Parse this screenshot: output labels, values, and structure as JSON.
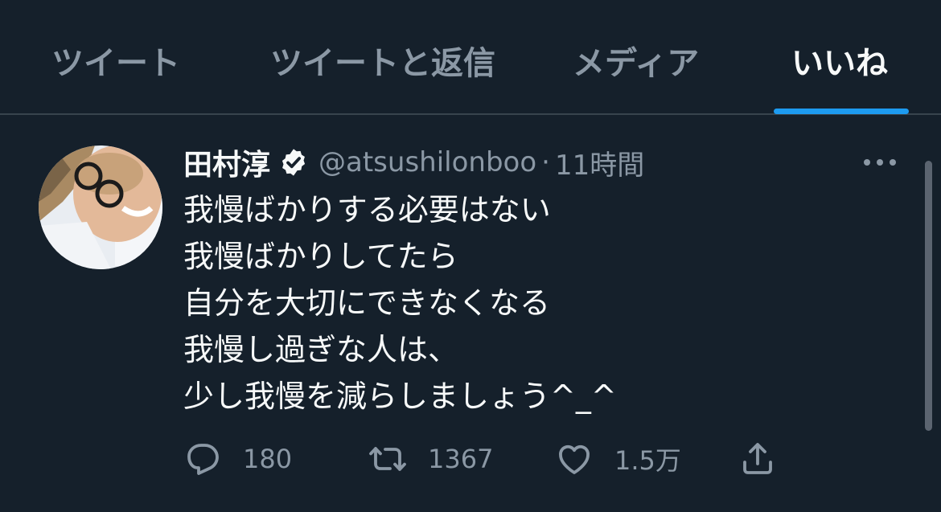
{
  "tabs": [
    {
      "label": "ツイート",
      "active": false
    },
    {
      "label": "ツイートと返信",
      "active": false
    },
    {
      "label": "メディア",
      "active": false
    },
    {
      "label": "いいね",
      "active": true
    }
  ],
  "tweet": {
    "author_name": "田村淳",
    "verified": true,
    "handle": "@atsushilonboo",
    "separator": "·",
    "time": "11時間",
    "lines": [
      "我慢ばかりする必要はない",
      "我慢ばかりしてたら",
      "自分を大切にできなくなる",
      "我慢し過ぎな人は、",
      "少し我慢を減らしましょう^_^"
    ],
    "replies": "180",
    "retweets": "1367",
    "likes": "1.5万"
  },
  "icons": {
    "verified": "verified-badge-icon",
    "more": "more-icon",
    "reply": "reply-icon",
    "retweet": "retweet-icon",
    "like": "heart-icon",
    "share": "share-icon"
  },
  "colors": {
    "background": "#15202b",
    "accent": "#1d9bf0",
    "text_primary": "#f7f9f9",
    "text_secondary": "#8b98a5",
    "divider": "#38444d"
  }
}
